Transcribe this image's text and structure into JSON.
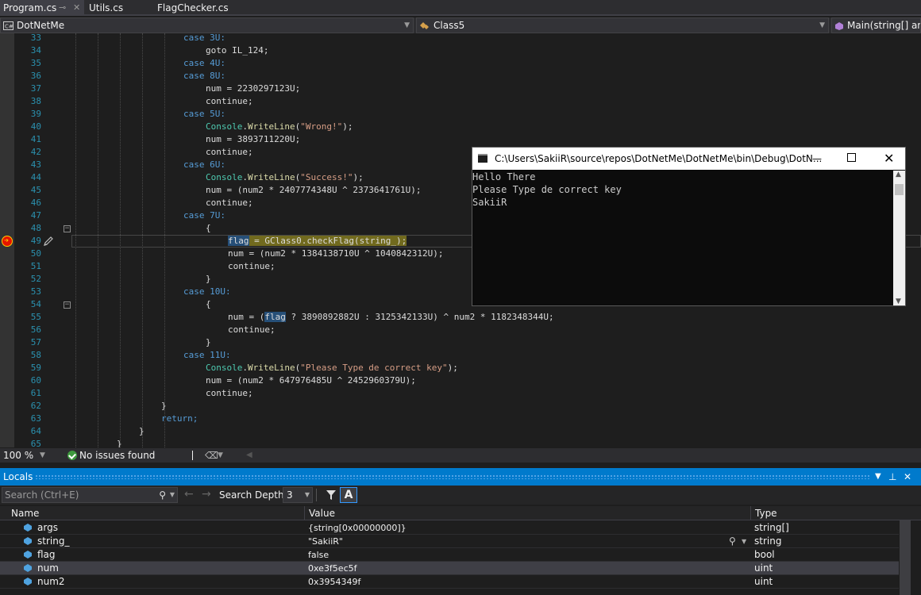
{
  "tabs": [
    {
      "label": "Program.cs",
      "active": true
    },
    {
      "label": "Utils.cs",
      "active": false
    },
    {
      "label": "FlagChecker.cs",
      "active": false
    }
  ],
  "tab_pin": "⊸",
  "tab_close": "✕",
  "nav": {
    "project": "DotNetMe",
    "class": "Class5",
    "member": "Main(string[] args)"
  },
  "code_lines": [
    {
      "n": "33"
    },
    {
      "n": "34"
    },
    {
      "n": "35"
    },
    {
      "n": "36"
    },
    {
      "n": "37"
    },
    {
      "n": "38"
    },
    {
      "n": "39"
    },
    {
      "n": "40"
    },
    {
      "n": "41"
    },
    {
      "n": "42"
    },
    {
      "n": "43"
    },
    {
      "n": "44"
    },
    {
      "n": "45"
    },
    {
      "n": "46"
    },
    {
      "n": "47"
    },
    {
      "n": "48"
    },
    {
      "n": "49"
    },
    {
      "n": "50"
    },
    {
      "n": "51"
    },
    {
      "n": "52"
    },
    {
      "n": "53"
    },
    {
      "n": "54"
    },
    {
      "n": "55"
    },
    {
      "n": "56"
    },
    {
      "n": "57"
    },
    {
      "n": "58"
    },
    {
      "n": "59"
    },
    {
      "n": "60"
    },
    {
      "n": "61"
    },
    {
      "n": "62"
    },
    {
      "n": "63"
    },
    {
      "n": "64"
    },
    {
      "n": "65"
    }
  ],
  "code": {
    "l33": "case 3U:",
    "l34": "goto IL_124;",
    "l35": "case 4U:",
    "l36": "case 8U:",
    "l37": "num = 2230297123U;",
    "l38": "continue;",
    "l39": "case 5U:",
    "l40_str": "\"Wrong!\"",
    "l41": "num = 3893711220U;",
    "l42": "continue;",
    "l43": "case 6U:",
    "l44_str": "\"Success!\"",
    "l45": "num = (num2 * 2407774348U ^ 2373641761U);",
    "l46": "continue;",
    "l47": "case 7U:",
    "l48": "{",
    "l49_a": "flag",
    "l49_b": " = ",
    "l49_c": "GClass0",
    "l49_d": ".",
    "l49_e": "checkFlag",
    "l49_f": "(string_);",
    "l50": "num = (num2 * 1384138710U ^ 1040842312U);",
    "l51": "continue;",
    "l52": "}",
    "l53": "case 10U:",
    "l54": "{",
    "l55_a": "num = (",
    "l55_b": "flag",
    "l55_c": " ? 3890892882U : 3125342133U) ^ num2 * 1182348344U;",
    "l56": "continue;",
    "l57": "}",
    "l58": "case 11U:",
    "l59_str": "\"Please Type de correct key\"",
    "l60": "num = (num2 * 647976485U ^ 2452960379U);",
    "l61": "continue;",
    "l62": "}",
    "l63": "return;",
    "l64": "}",
    "l65": "}",
    "console_type": "Console",
    "writeline": "WriteLine",
    "tail": ");"
  },
  "status": {
    "zoom": "100 %",
    "issues": "No issues found"
  },
  "locals": {
    "title": "Locals",
    "search_placeholder": "Search (Ctrl+E)",
    "search_depth_label": "Search Depth:",
    "search_depth_value": "3",
    "columns": [
      "Name",
      "Value",
      "Type"
    ],
    "rows": [
      {
        "name": "args",
        "value": "{string[0x00000000]}",
        "type": "string[]"
      },
      {
        "name": "string_",
        "value": "\"SakiiR\"",
        "type": "string"
      },
      {
        "name": "flag",
        "value": "false",
        "type": "bool"
      },
      {
        "name": "num",
        "value": "0xe3f5ec5f",
        "type": "uint"
      },
      {
        "name": "num2",
        "value": "0x3954349f",
        "type": "uint"
      }
    ]
  },
  "console": {
    "title": "C:\\Users\\SakiiR\\source\\repos\\DotNetMe\\DotNetMe\\bin\\Debug\\DotN...",
    "lines": [
      "Hello There",
      "Please Type de correct key",
      "SakiiR"
    ]
  },
  "colors": {
    "accent": "#007acc",
    "keyword": "#569cd6",
    "type": "#4ec9b0",
    "method": "#dcdcaa",
    "string": "#d69d85",
    "line_number": "#2b91af",
    "current_statement": "#716a1e"
  }
}
